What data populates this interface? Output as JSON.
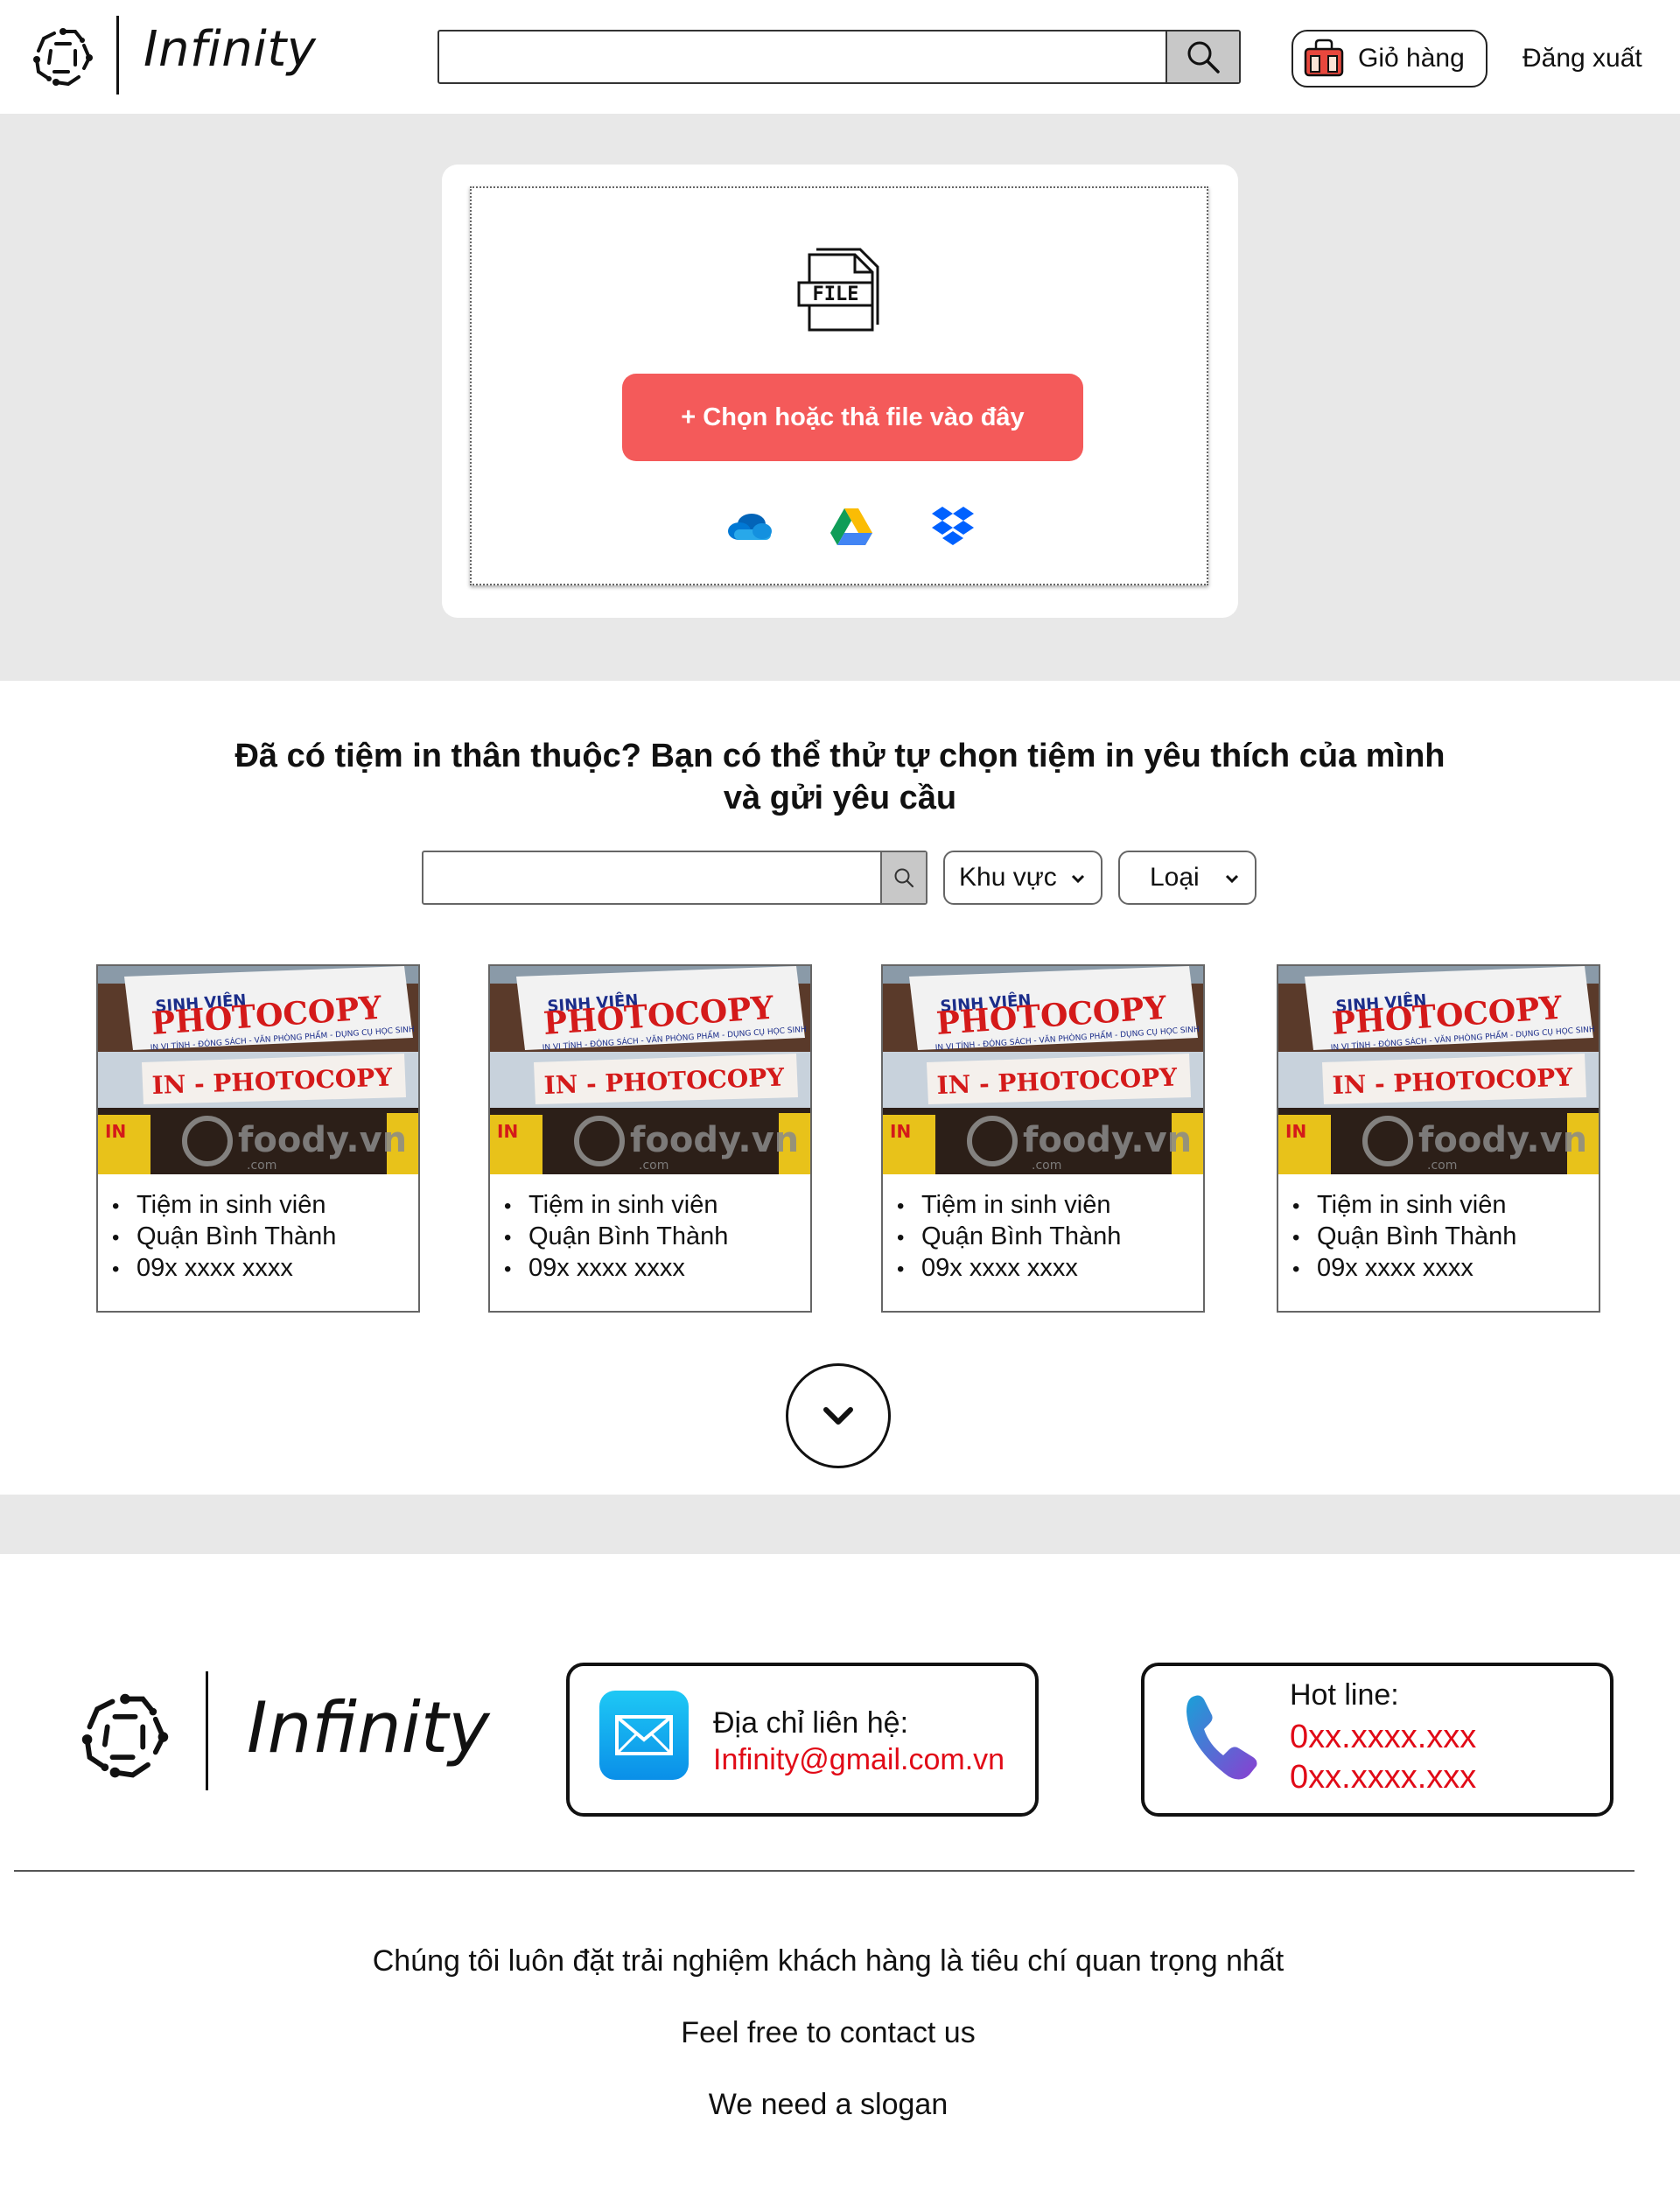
{
  "header": {
    "brand": "Infinity",
    "search_value": "",
    "search_icon": "search-icon",
    "cart_label": "Giỏ hàng",
    "cart_icon": "shopping-bag-icon",
    "logout_label": "Đăng xuất"
  },
  "upload": {
    "file_icon_text": "FILE",
    "choose_button_label": "+ Chọn hoặc thả file vào đây",
    "cloud_sources": [
      "onedrive-icon",
      "google-drive-icon",
      "dropbox-icon"
    ]
  },
  "shops": {
    "title_line1": "Đã có tiệm in thân thuộc? Bạn có thể thử tự chọn tiệm in yêu thích của mình",
    "title_line2": "và gửi yêu cầu",
    "search_value": "",
    "filters": {
      "area_label": "Khu vực",
      "type_label": "Loại"
    },
    "cards": [
      {
        "name": "Tiệm in sinh viên",
        "district": "Quận Bình Thành",
        "phone": "09x xxxx xxxx"
      },
      {
        "name": "Tiệm in sinh viên",
        "district": "Quận Bình Thành",
        "phone": "09x xxxx xxxx"
      },
      {
        "name": "Tiệm in sinh viên",
        "district": "Quận Bình Thành",
        "phone": "09x xxxx xxxx"
      },
      {
        "name": "Tiệm in sinh viên",
        "district": "Quận Bình Thành",
        "phone": "09x xxxx xxxx"
      }
    ],
    "photo_sign": {
      "top": "SINH VIÊN",
      "main": "PHOTOCOPY",
      "sub": "IN VI TÍNH - ĐÓNG SÁCH - VĂN PHÒNG PHẨM - DỤNG CỤ HỌC SINH",
      "lower": "IN - PHOTOCOPY",
      "watermark": "foody.vn",
      "watermark_sub": ".com"
    },
    "more_icon": "chevron-down-icon"
  },
  "footer": {
    "brand": "Infinity",
    "mail_label": "Địa chỉ liên hệ:",
    "mail_value": "Infinity@gmail.com.vn",
    "hotline_label": "Hot line:",
    "hotline_1": "0xx.xxxx.xxx",
    "hotline_2": "0xx.xxxx.xxx",
    "line1": "Chúng tôi luôn đặt trải nghiệm khách hàng là tiêu chí quan trọng nhất",
    "line2": "Feel free to contact us",
    "line3": "We need a slogan"
  },
  "colors": {
    "accent_button": "#f45a5a",
    "band_gray": "#e8e8e8",
    "contact_red": "#e10a17"
  }
}
